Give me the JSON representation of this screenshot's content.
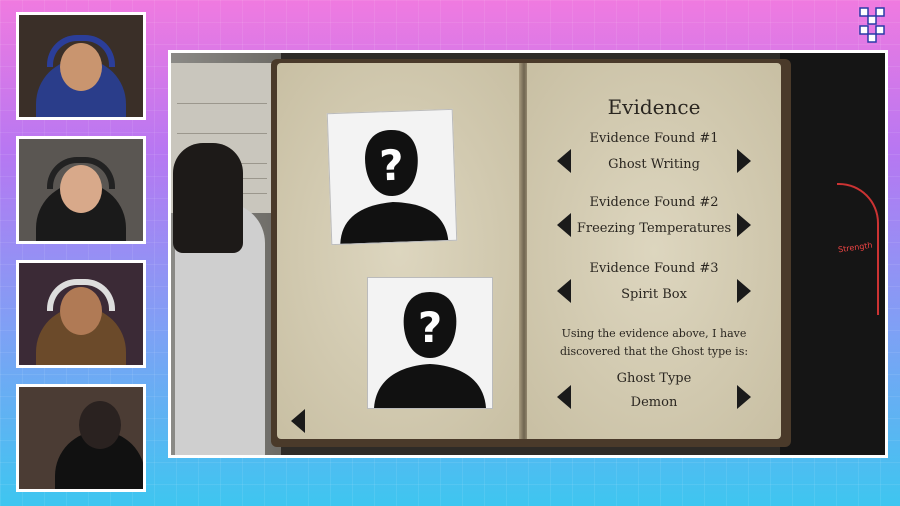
{
  "book": {
    "title": "Evidence",
    "evidence": [
      {
        "label": "Evidence Found #1",
        "value": "Ghost Writing"
      },
      {
        "label": "Evidence Found #2",
        "value": "Freezing Temperatures"
      },
      {
        "label": "Evidence Found #3",
        "value": "Spirit Box"
      }
    ],
    "conclusion": "Using the evidence above, I have discovered that the Ghost type is:",
    "ghost_type_label": "Ghost Type",
    "ghost_type_value": "Demon"
  },
  "hud": {
    "strength_label": "Strength"
  },
  "icons": {
    "unknown_photo": "silhouette-question-icon",
    "prev": "triangle-left-icon",
    "next": "triangle-right-icon"
  }
}
